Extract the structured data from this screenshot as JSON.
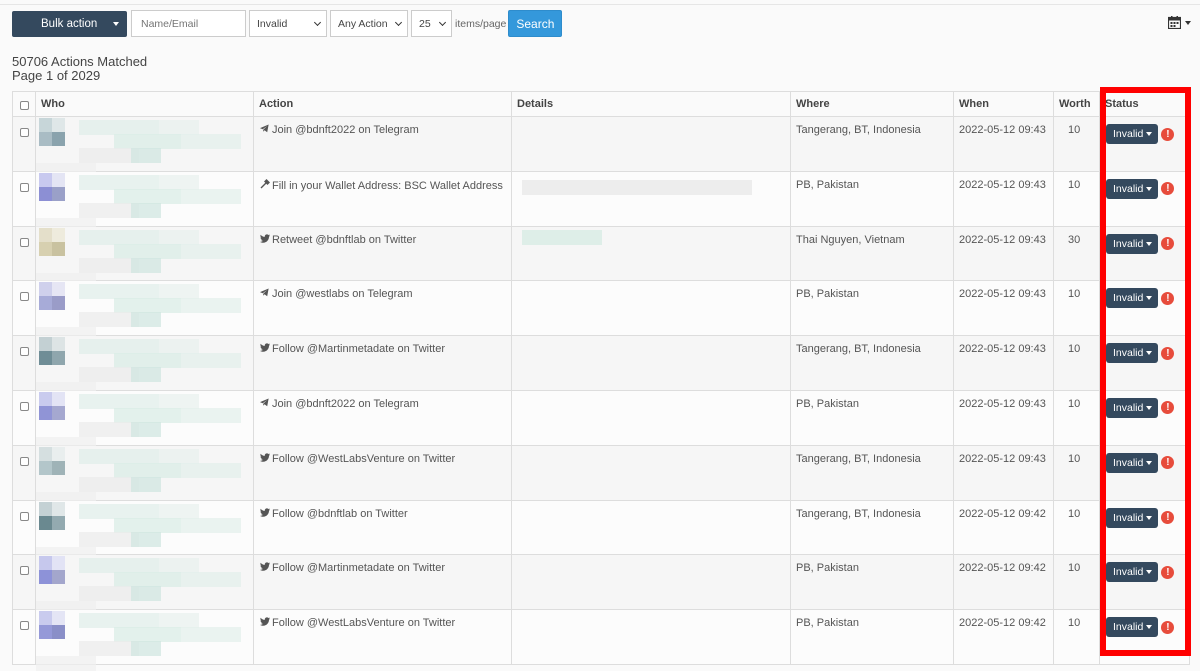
{
  "toolbar": {
    "bulk_action_label": "Bulk action",
    "search_placeholder": "Name/Email",
    "status_filter": "Invalid",
    "action_filter": "Any Action",
    "items_per_page": "25",
    "items_per_page_label": "items/page",
    "search_label": "Search",
    "calendar_icon": "calendar-icon"
  },
  "summary": {
    "matched": "50706 Actions Matched",
    "page": "Page 1 of 2029"
  },
  "table": {
    "headers": [
      "Who",
      "Action",
      "Details",
      "Where",
      "When",
      "Worth",
      "Status"
    ],
    "rows": [
      {
        "action_icon": "telegram-icon",
        "action": "Join @bdnft2022 on Telegram",
        "details": "",
        "where": "Tangerang, BT, Indonesia",
        "when": "2022-05-12 09:43",
        "worth": "10",
        "status": "Invalid"
      },
      {
        "action_icon": "wallet-icon",
        "action": "Fill in your Wallet Address: BSC Wallet Address",
        "details": "",
        "where": "PB, Pakistan",
        "when": "2022-05-12 09:43",
        "worth": "10",
        "status": "Invalid"
      },
      {
        "action_icon": "twitter-icon",
        "action": "Retweet @bdnftlab on Twitter",
        "details": "",
        "where": "Thai Nguyen, Vietnam",
        "when": "2022-05-12 09:43",
        "worth": "30",
        "status": "Invalid"
      },
      {
        "action_icon": "telegram-icon",
        "action": "Join @westlabs on Telegram",
        "details": "",
        "where": "PB, Pakistan",
        "when": "2022-05-12 09:43",
        "worth": "10",
        "status": "Invalid"
      },
      {
        "action_icon": "twitter-icon",
        "action": "Follow @Martinmetadate on Twitter",
        "details": "",
        "where": "Tangerang, BT, Indonesia",
        "when": "2022-05-12 09:43",
        "worth": "10",
        "status": "Invalid"
      },
      {
        "action_icon": "telegram-icon",
        "action": "Join @bdnft2022 on Telegram",
        "details": "",
        "where": "PB, Pakistan",
        "when": "2022-05-12 09:43",
        "worth": "10",
        "status": "Invalid"
      },
      {
        "action_icon": "twitter-icon",
        "action": "Follow @WestLabsVenture on Twitter",
        "details": "",
        "where": "Tangerang, BT, Indonesia",
        "when": "2022-05-12 09:43",
        "worth": "10",
        "status": "Invalid"
      },
      {
        "action_icon": "twitter-icon",
        "action": "Follow @bdnftlab on Twitter",
        "details": "",
        "where": "Tangerang, BT, Indonesia",
        "when": "2022-05-12 09:42",
        "worth": "10",
        "status": "Invalid"
      },
      {
        "action_icon": "twitter-icon",
        "action": "Follow @Martinmetadate on Twitter",
        "details": "",
        "where": "PB, Pakistan",
        "when": "2022-05-12 09:42",
        "worth": "10",
        "status": "Invalid"
      },
      {
        "action_icon": "twitter-icon",
        "action": "Follow @WestLabsVenture on Twitter",
        "details": "",
        "where": "PB, Pakistan",
        "when": "2022-05-12 09:42",
        "worth": "10",
        "status": "Invalid"
      }
    ]
  },
  "colors": {
    "primary_dark": "#34495e",
    "search_blue": "#3498db",
    "warning_red": "#e74c3c",
    "highlight_red": "#ff0000"
  }
}
